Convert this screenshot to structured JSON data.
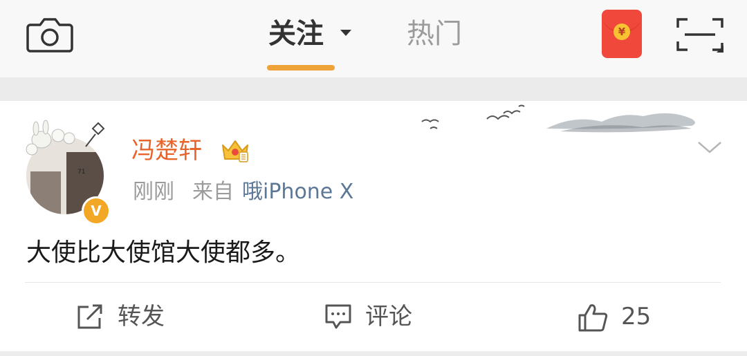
{
  "header": {
    "tabs": [
      {
        "label": "关注",
        "active": true
      },
      {
        "label": "热门",
        "active": false
      }
    ],
    "accent_color": "#f0a23a",
    "redpacket_symbol": "¥"
  },
  "post": {
    "username": "冯楚轩",
    "time": "刚刚",
    "source_prefix": "来自",
    "source": "哦iPhone X",
    "avatar_number": "71",
    "verified_symbol": "V",
    "text": "大使比大使馆大使都多。",
    "actions": {
      "repost_label": "转发",
      "comment_label": "评论",
      "like_count": "25"
    },
    "username_color": "#e8642b"
  }
}
